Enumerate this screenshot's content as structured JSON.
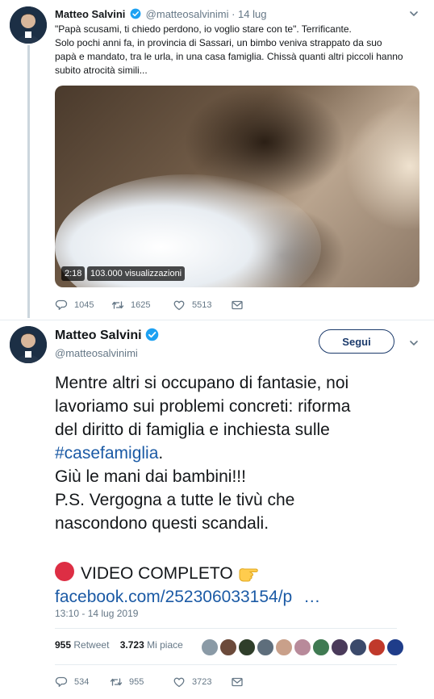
{
  "parent_tweet": {
    "name": "Matteo Salvini",
    "handle": "@matteosalvinimi",
    "separator": "·",
    "date": "14 lug",
    "text_lines": [
      "\"Papà scusami, ti chiedo perdono, io voglio stare con te\". Terrificante.",
      "Solo pochi anni fa, in provincia di Sassari, un bimbo veniva strappato da suo",
      "papà e mandato, tra le urla, in una casa famiglia. Chissà quanti altri piccoli hanno",
      "subito atrocità simili..."
    ],
    "video": {
      "duration": "2:18",
      "views": "103.000 visualizzazioni"
    },
    "actions": {
      "replies": "1045",
      "retweets": "1625",
      "likes": "5513"
    }
  },
  "main_tweet": {
    "name": "Matteo Salvini",
    "handle": "@matteosalvinimi",
    "follow_label": "Segui",
    "text": {
      "l1": "Mentre altri si occupano di fantasie, noi",
      "l2": "lavoriamo sui problemi concreti: riforma",
      "l3": "del diritto di famiglia e inchiesta sulle",
      "hashtag": "#casefamiglia",
      "l4_suffix": ".",
      "l5": "Giù le mani dai bambini!!!",
      "l6": "P.S. Vergogna a tutte le tivù che",
      "l7": "nascondono questi scandali.",
      "video_label": "VIDEO COMPLETO",
      "link": "facebook.com/252306033154/p",
      "link_ellipsis": "…"
    },
    "timestamp": "13:10 - 14 lug 2019",
    "stats": {
      "retweets_count": "955",
      "retweets_label": "Retweet",
      "likes_count": "3.723",
      "likes_label": "Mi piace"
    },
    "liker_colors": [
      "#8a9aa6",
      "#6b4a3a",
      "#2f3e2a",
      "#5e6e7c",
      "#c9a08a",
      "#b88a9a",
      "#3f7a52",
      "#4a3a5a",
      "#3b4a6b",
      "#c0392b",
      "#1f3d8a"
    ],
    "actions": {
      "replies": "534",
      "retweets": "955",
      "likes": "3723"
    }
  },
  "icons": {
    "verified": "verified-badge-icon",
    "reply": "reply-icon",
    "retweet": "retweet-icon",
    "like": "heart-icon",
    "dm": "envelope-icon",
    "more": "chevron-down-icon",
    "red_circle": "red-circle-emoji",
    "pointing_hand": "pointing-right-emoji"
  },
  "colors": {
    "link": "#1b5aa5",
    "verified": "#1da1f2",
    "muted": "#657786",
    "follow_border": "#1b3a6b"
  }
}
